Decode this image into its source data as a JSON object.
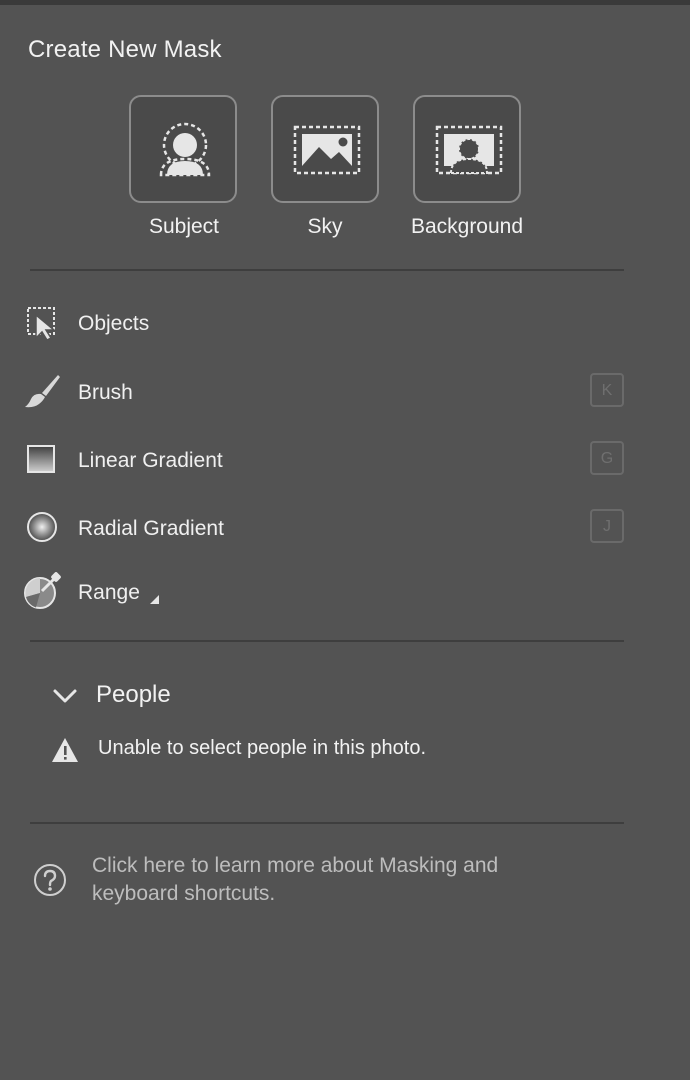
{
  "panel": {
    "title": "Create New Mask"
  },
  "mask_buttons": [
    {
      "label": "Subject",
      "icon": "subject-icon"
    },
    {
      "label": "Sky",
      "icon": "sky-icon"
    },
    {
      "label": "Background",
      "icon": "background-icon"
    }
  ],
  "tools": [
    {
      "label": "Objects",
      "icon": "objects-icon",
      "shortcut": ""
    },
    {
      "label": "Brush",
      "icon": "brush-icon",
      "shortcut": "K"
    },
    {
      "label": "Linear Gradient",
      "icon": "linear-gradient-icon",
      "shortcut": "G"
    },
    {
      "label": "Radial Gradient",
      "icon": "radial-gradient-icon",
      "shortcut": "J"
    },
    {
      "label": "Range",
      "icon": "range-icon",
      "shortcut": ""
    }
  ],
  "people": {
    "title": "People",
    "message": "Unable to select people in this photo.",
    "icon": "warning-icon",
    "toggle_icon": "chevron-down-icon"
  },
  "help": {
    "icon": "help-icon",
    "text": "Click here to learn more about Masking and keyboard shortcuts."
  },
  "colors": {
    "panel_background": "#535353",
    "button_background": "#4a4a4a",
    "button_border": "#8c8c8c",
    "text": "#f0f0f0",
    "muted_text": "#bdbdbd"
  }
}
